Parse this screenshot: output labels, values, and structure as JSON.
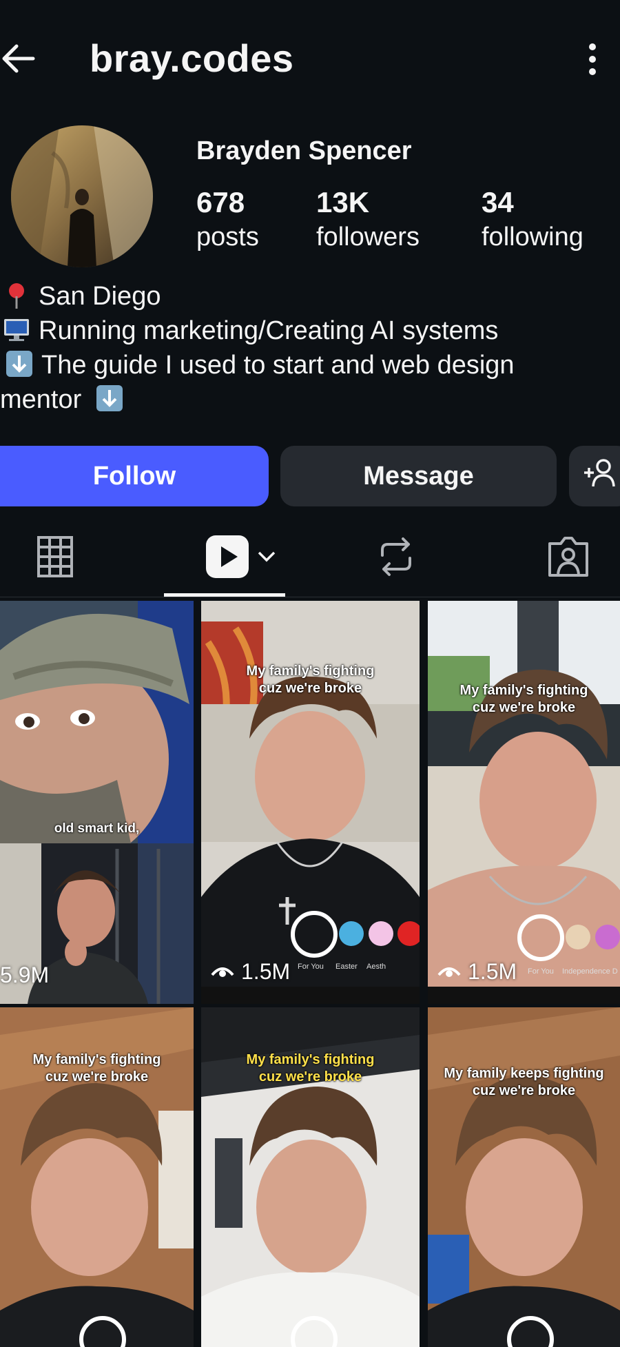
{
  "header": {
    "username": "bray.codes",
    "back_icon": "arrow-left-icon",
    "menu_icon": "more-vertical-icon"
  },
  "profile": {
    "full_name": "Brayden Spencer",
    "stats": [
      {
        "value": "678",
        "label": "posts"
      },
      {
        "value": "13K",
        "label": "followers"
      },
      {
        "value": "34",
        "label": "following"
      }
    ],
    "bio": [
      {
        "icon": "pin-icon",
        "text": "San Diego"
      },
      {
        "icon": "computer-icon",
        "text": "Running marketing/Creating AI systems"
      },
      {
        "icon": "down-arrow-box-icon",
        "text": "The guide I used to start and web design"
      },
      {
        "icon": "",
        "text": "mentor",
        "trailing_icon": "down-arrow-box-icon"
      }
    ]
  },
  "actions": {
    "follow_label": "Follow",
    "message_label": "Message",
    "add_person_icon": "add-person-icon"
  },
  "tabs": [
    {
      "name": "grid",
      "icon": "grid-icon"
    },
    {
      "name": "reels",
      "icon": "play-icon",
      "selected": true
    },
    {
      "name": "reposts",
      "icon": "repost-icon"
    },
    {
      "name": "tagged",
      "icon": "tagged-person-icon"
    }
  ],
  "grid": [
    {
      "caption": "old smart kid,",
      "views": "5.9M"
    },
    {
      "caption_line1": "My family's fighting",
      "caption_line2": "cuz we're broke",
      "views": "1.5M",
      "tab1": "For You",
      "tab2": "Easter",
      "tab3": "Aesth"
    },
    {
      "caption_line1": "My family's fighting",
      "caption_line2": "cuz we're broke",
      "views": "1.5M",
      "tab1": "For You",
      "tab2": "Independence D"
    },
    {
      "caption_line1": "My family's fighting",
      "caption_line2": "cuz we're broke",
      "views": ""
    },
    {
      "caption_line1": "My family's fighting",
      "caption_line2": "cuz we're broke",
      "views": ""
    },
    {
      "caption_line1": "My family keeps fighting",
      "caption_line2": "cuz we're broke",
      "views": ""
    }
  ],
  "colors": {
    "background": "#0c1014",
    "follow": "#4a5cff",
    "secondary_button": "#262a30",
    "caption_yellow": "#ffe04a"
  }
}
